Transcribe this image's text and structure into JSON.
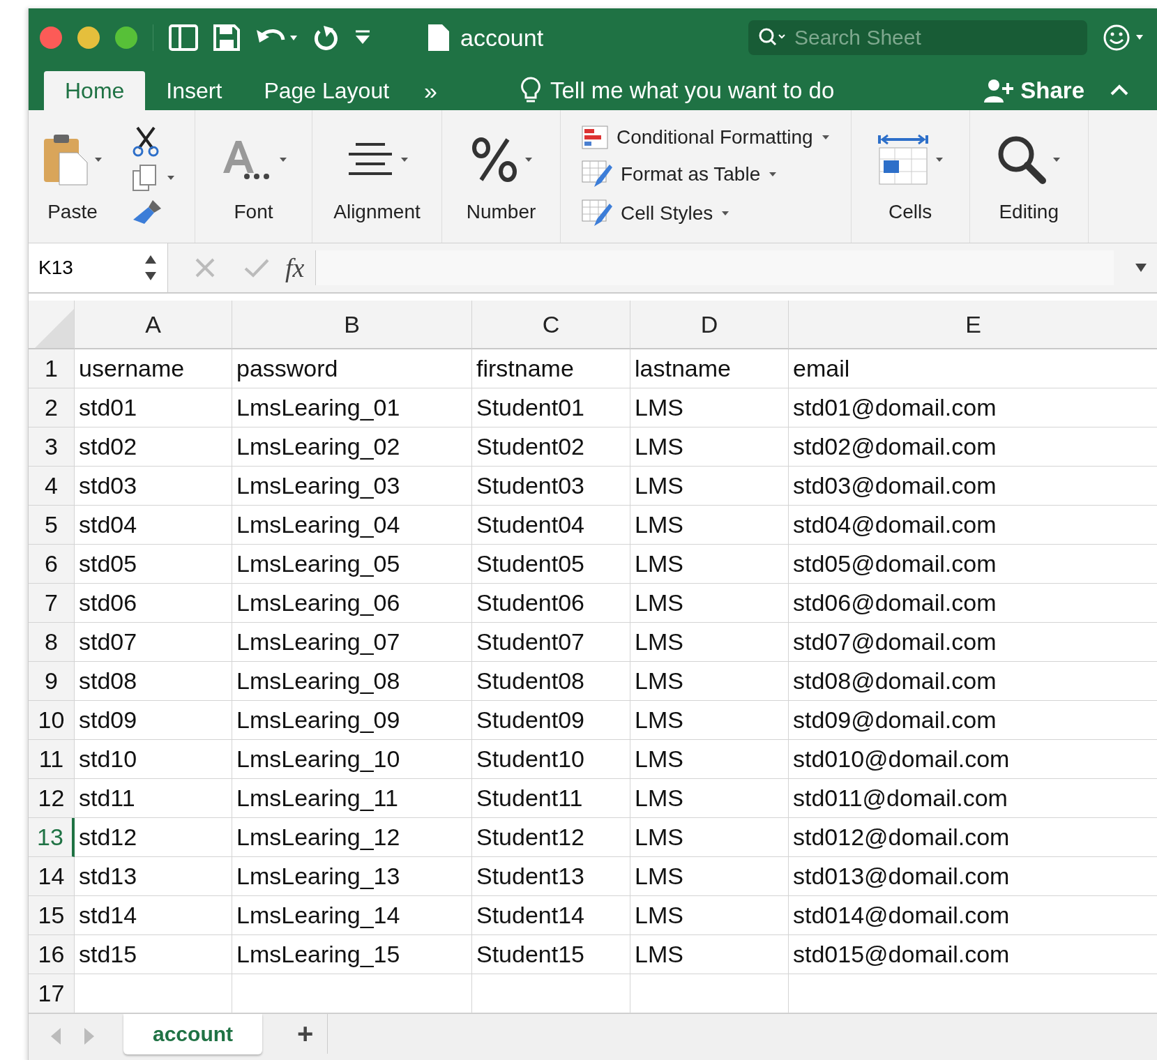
{
  "window": {
    "title": "account",
    "search": {
      "placeholder": "Search Sheet"
    }
  },
  "tabs": [
    {
      "label": "Home",
      "selected": true
    },
    {
      "label": "Insert",
      "selected": false
    },
    {
      "label": "Page Layout",
      "selected": false
    }
  ],
  "tabs_overflow": "»",
  "tell_me": "Tell me what you want to do",
  "share": "Share",
  "ribbon": {
    "paste": "Paste",
    "groups": [
      {
        "label": "Font",
        "kind": "font"
      },
      {
        "label": "Alignment",
        "kind": "align"
      },
      {
        "label": "Number",
        "kind": "number"
      }
    ],
    "styles": [
      {
        "label": "Conditional Formatting",
        "kind": "conditional"
      },
      {
        "label": "Format as Table",
        "kind": "table"
      },
      {
        "label": "Cell Styles",
        "kind": "styles"
      }
    ],
    "end_groups": [
      {
        "label": "Cells",
        "kind": "cells"
      },
      {
        "label": "Editing",
        "kind": "editing"
      }
    ]
  },
  "formula_bar": {
    "name_box": "K13",
    "fx": "fx"
  },
  "table": {
    "columns": [
      "A",
      "B",
      "C",
      "D",
      "E"
    ],
    "rows": [
      {
        "number": "1",
        "selected": false,
        "cells": [
          "username",
          "password",
          "firstname",
          "lastname",
          "email"
        ]
      },
      {
        "number": "2",
        "selected": false,
        "cells": [
          "std01",
          "LmsLearing_01",
          "Student01",
          "LMS",
          "std01@domail.com"
        ]
      },
      {
        "number": "3",
        "selected": false,
        "cells": [
          "std02",
          "LmsLearing_02",
          "Student02",
          "LMS",
          "std02@domail.com"
        ]
      },
      {
        "number": "4",
        "selected": false,
        "cells": [
          "std03",
          "LmsLearing_03",
          "Student03",
          "LMS",
          "std03@domail.com"
        ]
      },
      {
        "number": "5",
        "selected": false,
        "cells": [
          "std04",
          "LmsLearing_04",
          "Student04",
          "LMS",
          "std04@domail.com"
        ]
      },
      {
        "number": "6",
        "selected": false,
        "cells": [
          "std05",
          "LmsLearing_05",
          "Student05",
          "LMS",
          "std05@domail.com"
        ]
      },
      {
        "number": "7",
        "selected": false,
        "cells": [
          "std06",
          "LmsLearing_06",
          "Student06",
          "LMS",
          "std06@domail.com"
        ]
      },
      {
        "number": "8",
        "selected": false,
        "cells": [
          "std07",
          "LmsLearing_07",
          "Student07",
          "LMS",
          "std07@domail.com"
        ]
      },
      {
        "number": "9",
        "selected": false,
        "cells": [
          "std08",
          "LmsLearing_08",
          "Student08",
          "LMS",
          "std08@domail.com"
        ]
      },
      {
        "number": "10",
        "selected": false,
        "cells": [
          "std09",
          "LmsLearing_09",
          "Student09",
          "LMS",
          "std09@domail.com"
        ]
      },
      {
        "number": "11",
        "selected": false,
        "cells": [
          "std10",
          "LmsLearing_10",
          "Student10",
          "LMS",
          "std010@domail.com"
        ]
      },
      {
        "number": "12",
        "selected": false,
        "cells": [
          "std11",
          "LmsLearing_11",
          "Student11",
          "LMS",
          "std011@domail.com"
        ]
      },
      {
        "number": "13",
        "selected": true,
        "cells": [
          "std12",
          "LmsLearing_12",
          "Student12",
          "LMS",
          "std012@domail.com"
        ]
      },
      {
        "number": "14",
        "selected": false,
        "cells": [
          "std13",
          "LmsLearing_13",
          "Student13",
          "LMS",
          "std013@domail.com"
        ]
      },
      {
        "number": "15",
        "selected": false,
        "cells": [
          "std14",
          "LmsLearing_14",
          "Student14",
          "LMS",
          "std014@domail.com"
        ]
      },
      {
        "number": "16",
        "selected": false,
        "cells": [
          "std15",
          "LmsLearing_15",
          "Student15",
          "LMS",
          "std015@domail.com"
        ]
      },
      {
        "number": "17",
        "selected": false,
        "cells": []
      }
    ]
  },
  "sheet_tabs": [
    {
      "label": "account",
      "selected": true
    }
  ],
  "add_sheet": "+"
}
